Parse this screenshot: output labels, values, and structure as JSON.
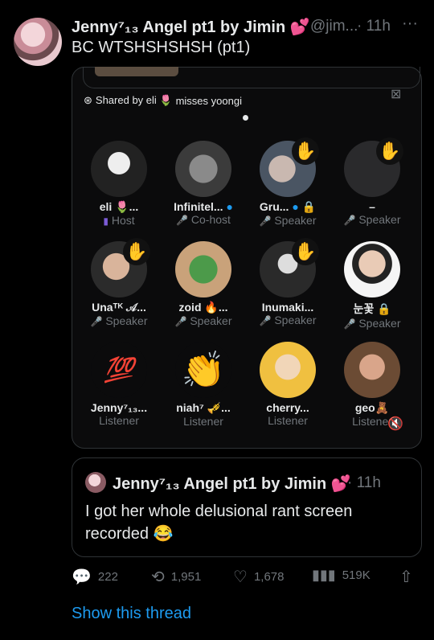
{
  "tweet": {
    "author_name": "Jenny⁷₁₃ Angel pt1 by Jimin 💕",
    "handle": "@jim...",
    "time": "· 11h",
    "text": "BC WTSHSHSHSH (pt1)"
  },
  "space": {
    "shared_by": "Shared by eli 🌷",
    "shared_note": "misses yoongi",
    "participants": [
      {
        "name": "eli 🌷...",
        "role": "Host",
        "raised": false
      },
      {
        "name": "Infinitel...",
        "role": "Co-host",
        "raised": false
      },
      {
        "name": "Gru...",
        "role": "Speaker",
        "raised": true
      },
      {
        "name": "–",
        "role": "Speaker",
        "raised": true
      },
      {
        "name": "Unaᵀᴷ 𝒜...",
        "role": "Speaker",
        "raised": true
      },
      {
        "name": "zoid 🔥...",
        "role": "Speaker",
        "raised": false
      },
      {
        "name": "Inumaki...",
        "role": "Speaker",
        "raised": true
      },
      {
        "name": "눈꽃",
        "role": "Speaker",
        "raised": false
      },
      {
        "name": "Jenny⁷₁₃...",
        "role": "Listener",
        "raised": false
      },
      {
        "name": "niah⁷ 🎺...",
        "role": "Listener",
        "raised": false
      },
      {
        "name": "cherry...",
        "role": "Listener",
        "raised": false
      },
      {
        "name": "geo🧸",
        "role": "Listener",
        "raised": false
      }
    ]
  },
  "quote": {
    "author_name": "Jenny⁷₁₃ Angel pt1 by Jimin 💕",
    "time": "· 11h",
    "text": "I got her whole delusional rant screen recorded 😂"
  },
  "actions": {
    "replies": "222",
    "retweets": "1,951",
    "likes": "1,678",
    "views": "519K"
  },
  "show_thread": "Show this thread",
  "colors": {
    "link": "#1d9bf0",
    "muted": "#71767b",
    "text": "#e7e9ea",
    "bg": "#000000"
  }
}
